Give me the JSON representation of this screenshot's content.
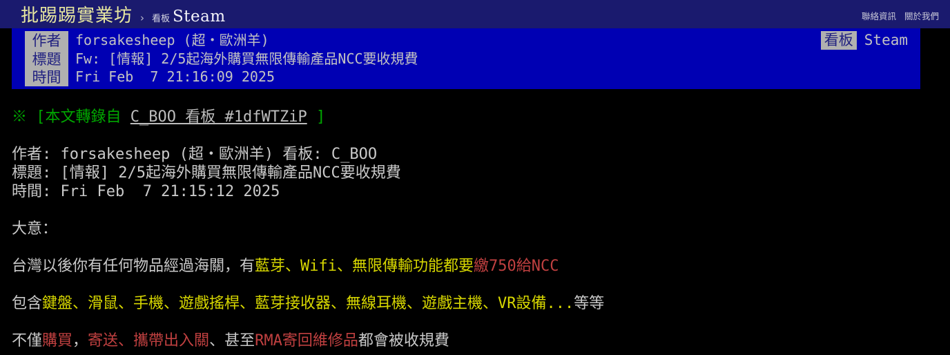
{
  "navbar": {
    "site_title": "批踢踢實業坊",
    "separator": "›",
    "board_prefix": "看板",
    "board_name": "Steam",
    "links": [
      {
        "label": "聯絡資訊"
      },
      {
        "label": "關於我們"
      }
    ]
  },
  "article_meta": {
    "labels": {
      "author": "作者",
      "title": "標題",
      "time": "時間"
    },
    "values": {
      "author": "forsakesheep (超・歐洲羊)",
      "title": "Fw: [情報] 2/5起海外購買無限傳輸產品NCC要收規費",
      "time": "Fri Feb  7 21:16:09 2025"
    },
    "board_chip_label": "看板",
    "board_chip_value": "Steam"
  },
  "content": {
    "forward_notice": {
      "marker": "※",
      "prefix": "[本文轉錄自",
      "link": "C_BOO 看板 #1dfWTZiP",
      "suffix": "]"
    },
    "original_meta": {
      "author_line": "作者: forsakesheep (超・歐洲羊) 看板: C_BOO",
      "title_line": "標題: [情報] 2/5起海外購買無限傳輸產品NCC要收規費",
      "time_line": "時間: Fri Feb  7 21:15:12 2025"
    },
    "summary_heading": "大意：",
    "line_customs": {
      "part1_white": "台灣以後你有任何物品經過海關，有",
      "part2_yellow": "藍芽、Wifi、無限傳輸功能都要",
      "part3_red": "繳750給NCC"
    },
    "line_devices": {
      "part1_white": "包含",
      "part2_yellow": "鍵盤、滑鼠、手機、遊戲搖桿、藍芽接收器、無線耳機、遊戲主機、VR設備...",
      "part3_white": "等等"
    },
    "line_scope": {
      "part1_white": "不僅",
      "part2_red": "購買",
      "part3_white": "，",
      "part4_red": "寄送、攜帶出入關",
      "part5_white": "、",
      "part6_white2": "甚至",
      "part7_red": "RMA寄回維修品",
      "part8_white": "都會被收規費"
    }
  },
  "colors": {
    "navbar_bg": "#1a1a6e",
    "meta_band_bg": "#0000b3",
    "chip_bg": "#b0b0b0",
    "chip_text": "#202080",
    "body_bg": "#000000",
    "body_text": "#c9c9c9",
    "green": "#00a800",
    "yellow": "#d7d700",
    "red": "#c04040",
    "site_title": "#e8e8a0"
  }
}
